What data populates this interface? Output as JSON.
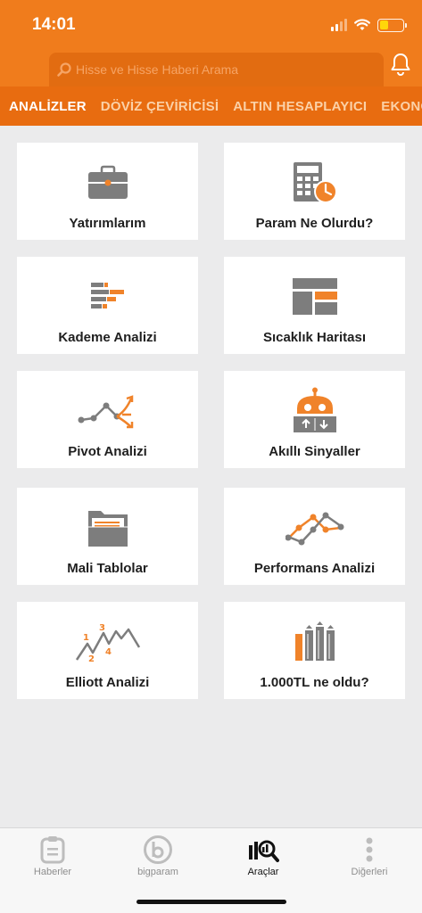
{
  "status_bar": {
    "time": "14:01"
  },
  "search": {
    "placeholder": "Hisse ve Hisse Haberi Arama"
  },
  "tabs": [
    "ANALİZLER",
    "DÖVİZ ÇEVİRİCİSİ",
    "ALTIN HESAPLAYICI",
    "EKONOMİ"
  ],
  "cards": [
    {
      "label": "Yatırımlarım",
      "icon": "briefcase-icon"
    },
    {
      "label": "Param Ne Olurdu?",
      "icon": "calculator-clock-icon"
    },
    {
      "label": "Kademe Analizi",
      "icon": "depth-bars-icon"
    },
    {
      "label": "Sıcaklık Haritası",
      "icon": "heatmap-icon"
    },
    {
      "label": "Pivot Analizi",
      "icon": "pivot-icon"
    },
    {
      "label": "Akıllı Sinyaller",
      "icon": "robot-icon"
    },
    {
      "label": "Mali Tablolar",
      "icon": "folder-icon"
    },
    {
      "label": "Performans Analizi",
      "icon": "performance-lines-icon"
    },
    {
      "label": "Elliott Analizi",
      "icon": "elliott-wave-icon"
    },
    {
      "label": "1.000TL ne oldu?",
      "icon": "growth-bars-icon"
    }
  ],
  "bottom_nav": [
    {
      "label": "Haberler",
      "icon": "news-icon"
    },
    {
      "label": "bigparam",
      "icon": "bigparam-icon"
    },
    {
      "label": "Araçlar",
      "icon": "tools-chart-search-icon"
    },
    {
      "label": "Diğerleri",
      "icon": "more-dots-icon"
    }
  ],
  "colors": {
    "brand_orange": "#f07c1c",
    "tab_strip": "#e86c10",
    "icon_grey": "#7d7d7d",
    "icon_orange": "#f0832a"
  }
}
